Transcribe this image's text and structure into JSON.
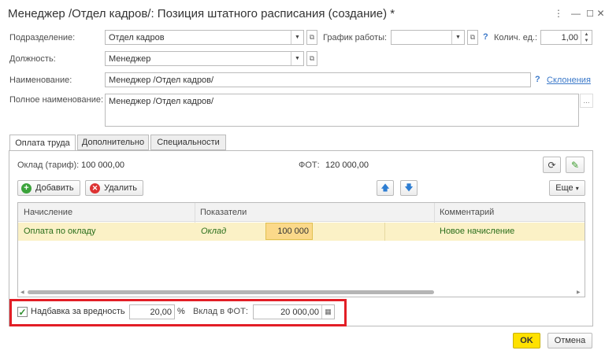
{
  "window": {
    "title": "Менеджер /Отдел кадров/: Позиция штатного расписания (создание) *",
    "menu_icon": "more-vert-icon",
    "minimize_icon": "minimize-icon",
    "maximize_icon": "maximize-icon",
    "close_icon": "close-icon"
  },
  "form": {
    "department_label": "Подразделение:",
    "department_value": "Отдел кадров",
    "schedule_label": "График работы:",
    "schedule_value": "",
    "schedule_help": "?",
    "units_label": "Колич. ед.:",
    "units_value": "1,00",
    "position_label": "Должность:",
    "position_value": "Менеджер",
    "name_label": "Наименование:",
    "name_value": "Менеджер /Отдел кадров/",
    "name_help": "?",
    "declensions_link": "Склонения",
    "fullname_label": "Полное наименование:",
    "fullname_value": "Менеджер /Отдел кадров/",
    "fullname_btn": "..."
  },
  "tabs": [
    {
      "label": "Оплата труда",
      "active": true
    },
    {
      "label": "Дополнительно",
      "active": false
    },
    {
      "label": "Специальности",
      "active": false
    }
  ],
  "pay": {
    "salary_label": "Оклад (тариф):",
    "salary_value": "100 000,00",
    "fot_label": "ФОТ:",
    "fot_value": "120 000,00",
    "add_button": "Добавить",
    "delete_button": "Удалить",
    "more_button": "Еще",
    "more_arrow": "▾"
  },
  "table": {
    "columns": [
      "Начисление",
      "Показатели",
      "Комментарий"
    ],
    "rows": [
      {
        "accrual": "Оплата по окладу",
        "indicator": "Оклад",
        "indicator_value": "100 000",
        "comment": "Новое начисление"
      }
    ]
  },
  "bonus": {
    "checked": true,
    "label": "Надбавка за вредность",
    "percent_value": "20,00",
    "percent_sign": "%",
    "contribution_label": "Вклад в ФОТ:",
    "contribution_value": "20 000,00"
  },
  "footer": {
    "ok_button": "OK",
    "cancel_button": "Отмена"
  },
  "colors": {
    "accent_yellow": "#ffe100",
    "row_highlight": "#fbf1c6",
    "highlight_box": "#e21e26",
    "link_blue": "#3a78c9",
    "row_text_green": "#2a6e1b"
  }
}
